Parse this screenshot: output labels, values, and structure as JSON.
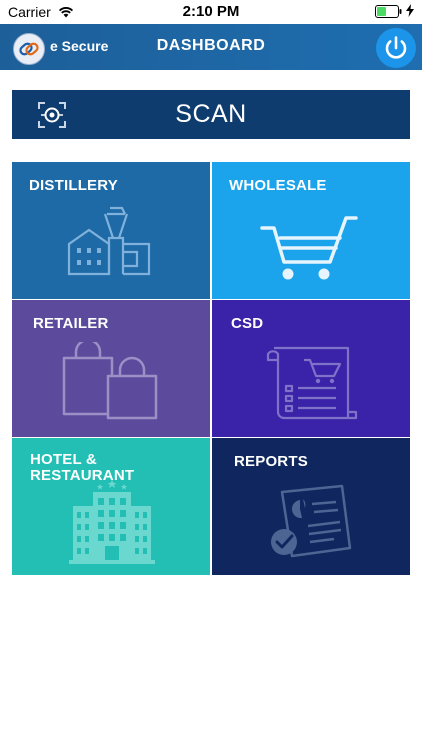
{
  "status_bar": {
    "carrier": "Carrier",
    "time": "2:10 PM",
    "wifi_icon": "wifi-icon",
    "battery_icon": "battery-icon",
    "charging_icon": "charging-bolt-icon"
  },
  "header": {
    "brand": "e Secure",
    "title": "DASHBOARD",
    "logo_icon": "link-logo-icon",
    "power_icon": "power-icon",
    "color": "#1e6eb0",
    "power_color": "#1b94ea"
  },
  "scan": {
    "label": "SCAN",
    "icon": "scan-icon",
    "color": "#0f3c6e"
  },
  "tiles": [
    {
      "label": "DISTILLERY",
      "icon": "distillery-icon",
      "color": "#1d6aa7"
    },
    {
      "label": "WHOLESALE",
      "icon": "cart-icon",
      "color": "#1ba3ec"
    },
    {
      "label": "RETAILER",
      "icon": "shopping-bags-icon",
      "color": "#5c4a9d"
    },
    {
      "label": "CSD",
      "icon": "receipt-cart-icon",
      "color": "#3a23a8"
    },
    {
      "label_line1": "HOTEL &",
      "label_line2": "RESTAURANT",
      "icon": "hotel-building-icon",
      "color": "#23bfb4"
    },
    {
      "label": "REPORTS",
      "icon": "report-document-icon",
      "color": "#0f275e"
    }
  ]
}
